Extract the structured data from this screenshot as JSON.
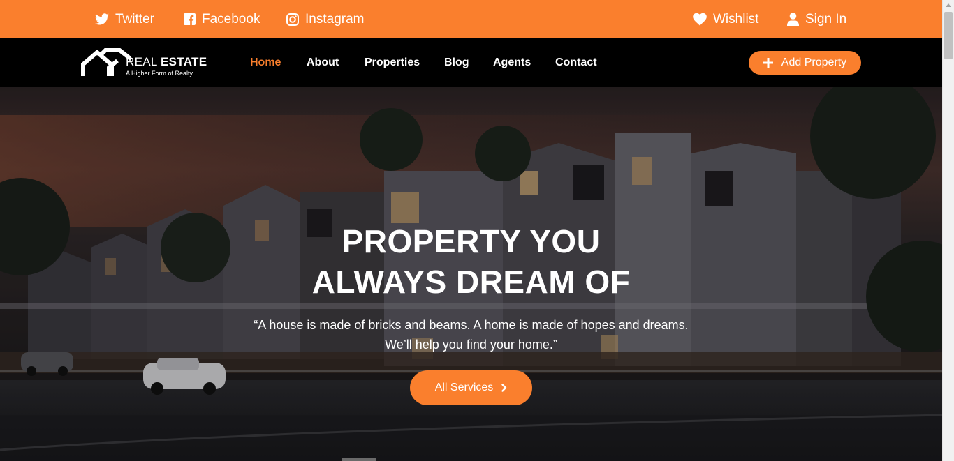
{
  "topbar": {
    "twitter": "Twitter",
    "facebook": "Facebook",
    "instagram": "Instagram",
    "wishlist": "Wishlist",
    "sign_in": "Sign In"
  },
  "logo": {
    "name_light": "REAL",
    "name_bold": "ESTATE",
    "tagline": "A Higher Form of Realty"
  },
  "nav": {
    "home": "Home",
    "about": "About",
    "properties": "Properties",
    "blog": "Blog",
    "agents": "Agents",
    "contact": "Contact",
    "active": "Home"
  },
  "add_property": "Add Property",
  "hero": {
    "title_line1": "PROPERTY YOU",
    "title_line2": "ALWAYS DREAM OF",
    "quote_line1": "“A house is made of bricks and beams. A home is made of hopes and dreams.",
    "quote_line2": "We’ll help you find your home.”",
    "button": "All Services"
  },
  "colors": {
    "accent": "#fa7f2d",
    "nav_background": "#000000",
    "text": "#ffffff"
  },
  "icons": [
    "twitter-icon",
    "facebook-icon",
    "instagram-icon",
    "heart-icon",
    "user-icon",
    "house-logo-icon",
    "plus-icon",
    "chevron-right-icon"
  ]
}
